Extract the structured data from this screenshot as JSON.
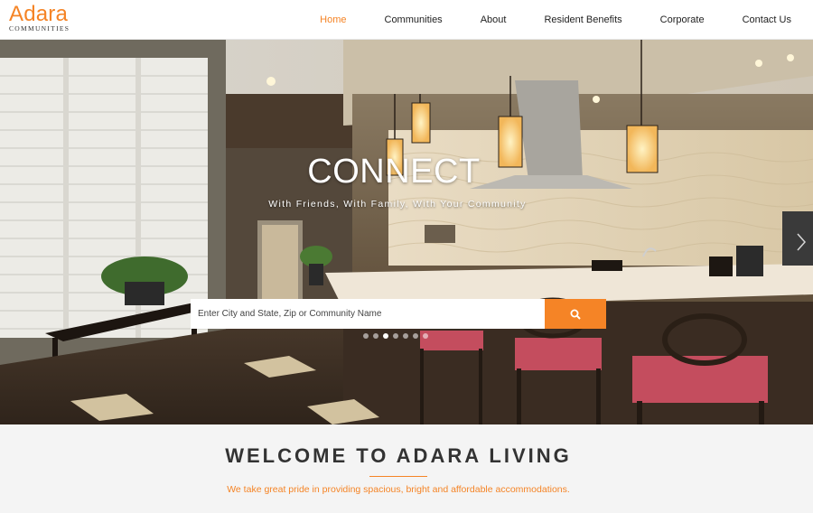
{
  "header": {
    "logo_word": "Adara",
    "logo_sub": "COMMUNITIES",
    "nav": [
      {
        "label": "Home",
        "active": true
      },
      {
        "label": "Communities"
      },
      {
        "label": "About"
      },
      {
        "label": "Resident Benefits"
      },
      {
        "label": "Corporate"
      },
      {
        "label": "Contact Us"
      }
    ]
  },
  "hero": {
    "title": "CONNECT",
    "subtitle": "With Friends, With Family, With Your Community",
    "search_placeholder": "Enter City and State, Zip or Community Name",
    "search_icon": "search-icon",
    "slides_count": 7,
    "active_slide": 3
  },
  "welcome": {
    "title": "WELCOME TO ADARA LIVING",
    "text": "We take great pride in providing spacious, bright and affordable accommodations."
  },
  "colors": {
    "accent": "#f58426",
    "text_dark": "#333333",
    "background": "#f4f4f4"
  }
}
